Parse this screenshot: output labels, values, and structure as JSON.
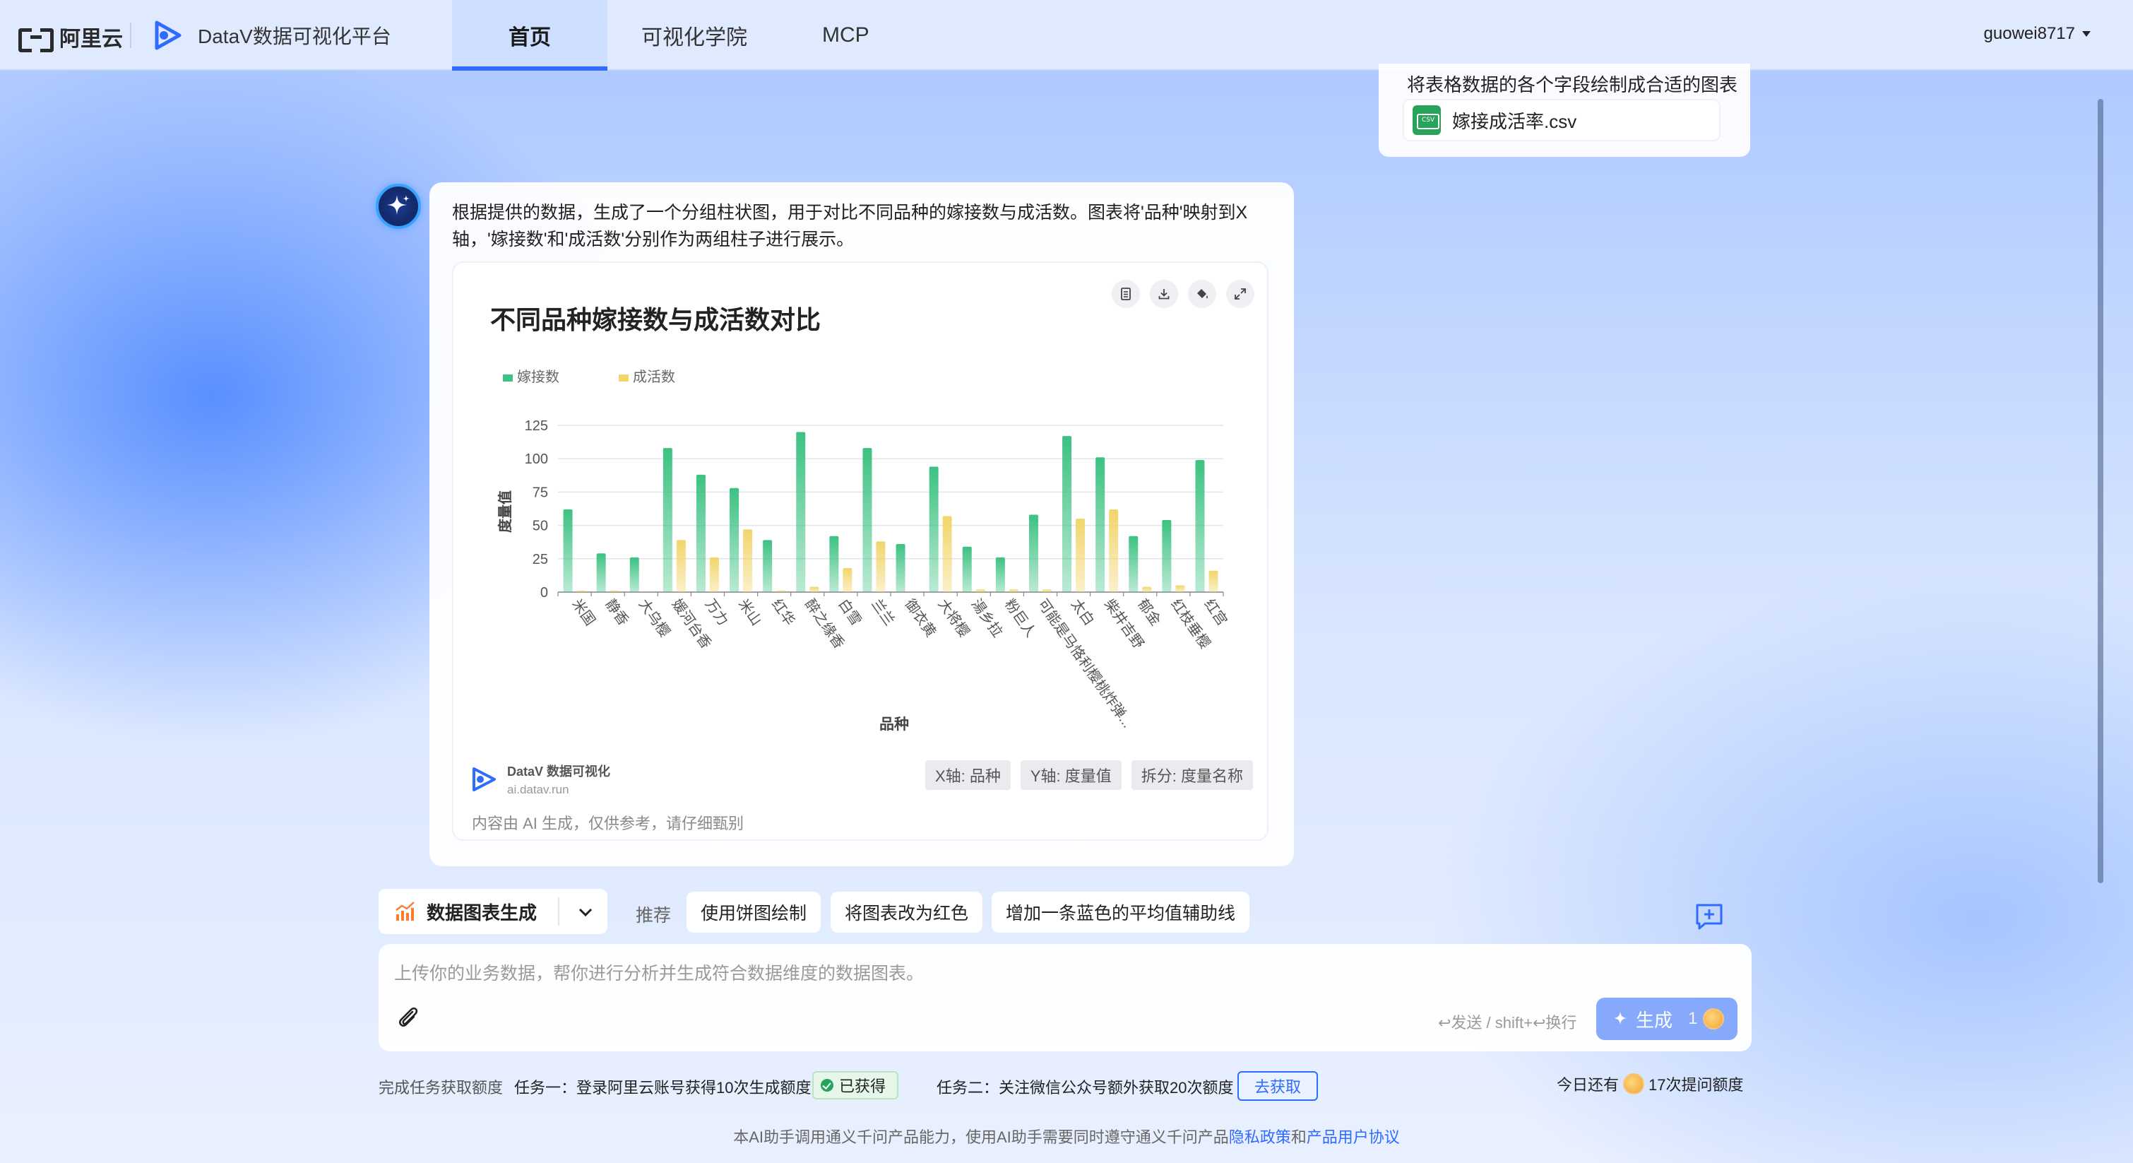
{
  "header": {
    "aliyun_text": "阿里云",
    "product_name": "DataV数据可视化平台",
    "tabs": [
      {
        "label": "首页",
        "active": true
      },
      {
        "label": "可视化学院",
        "active": false
      },
      {
        "label": "MCP",
        "active": false
      }
    ],
    "username": "guowei8717"
  },
  "user_message": {
    "text": "将表格数据的各个字段绘制成合适的图表",
    "file_name": "嫁接成活率.csv"
  },
  "ai_message": {
    "text": "根据提供的数据，生成了一个分组柱状图，用于对比不同品种的嫁接数与成活数。图表将'品种'映射到X轴，'嫁接数'和'成活数'分别作为两组柱子进行展示。",
    "chart_footer": {
      "brand_line1": "DataV 数据可视化",
      "brand_line2": "ai.datav.run",
      "disclaimer": "内容由 AI 生成，仅供参考，请仔细甄别",
      "tags": [
        "X轴: 品种",
        "Y轴: 度量值",
        "拆分: 度量名称"
      ]
    }
  },
  "chart_data": {
    "type": "bar",
    "title": "不同品种嫁接数与成活数对比",
    "xlabel": "品种",
    "ylabel": "度量值",
    "ylim": [
      0,
      125
    ],
    "yticks": [
      0,
      25,
      50,
      75,
      100,
      125
    ],
    "legend_position": "top-left",
    "grid": true,
    "categories": [
      "米国",
      "静香",
      "大乌樱",
      "媛河台香",
      "万力",
      "米山",
      "红华",
      "醉之缘香",
      "白雪",
      "兰兰",
      "御衣黄",
      "大将樱",
      "湯乡拉",
      "粉巨人",
      "可能是马恪利樱桃炸弹...",
      "太白",
      "柴井吉野",
      "郁金",
      "红枝垂樱",
      "红宫"
    ],
    "series": [
      {
        "name": "嫁接数",
        "color": "#3cc282",
        "values": [
          62,
          29,
          26,
          108,
          88,
          78,
          39,
          120,
          42,
          108,
          36,
          94,
          34,
          26,
          58,
          117,
          101,
          42,
          54,
          99
        ]
      },
      {
        "name": "成活数",
        "color": "#f2d56b",
        "values": [
          1,
          1,
          0,
          39,
          26,
          47,
          1,
          4,
          18,
          38,
          0,
          57,
          2,
          2,
          2,
          55,
          62,
          4,
          5,
          16
        ]
      }
    ]
  },
  "actions": {
    "mode_label": "数据图表生成",
    "recommend_label": "推荐",
    "chips": [
      "使用饼图绘制",
      "将图表改为红色",
      "增加一条蓝色的平均值辅助线"
    ]
  },
  "input": {
    "placeholder": "上传你的业务数据，帮你进行分析并生成符合数据维度的数据图表。",
    "send_hint": "↩发送 / shift+↩换行",
    "generate_label": "生成",
    "generate_count": "1"
  },
  "tasks": {
    "intro": "完成任务获取额度",
    "task1": "任务一：登录阿里云账号获得10次生成额度",
    "task1_status": "已获得",
    "task2": "任务二：关注微信公众号额外获取20次额度",
    "task2_button": "去获取",
    "quota_prefix": "今日还有",
    "quota_suffix": "17次提问额度"
  },
  "footer": {
    "text": "本AI助手调用通义千问产品能力，使用AI助手需要同时遵守通义千问产品",
    "privacy_link": "隐私政策",
    "and": "和",
    "agreement_link": "产品用户协议"
  },
  "colors": {
    "accent": "#2f6bff",
    "bar_primary": "#3cc282",
    "bar_secondary": "#f2d56b"
  }
}
